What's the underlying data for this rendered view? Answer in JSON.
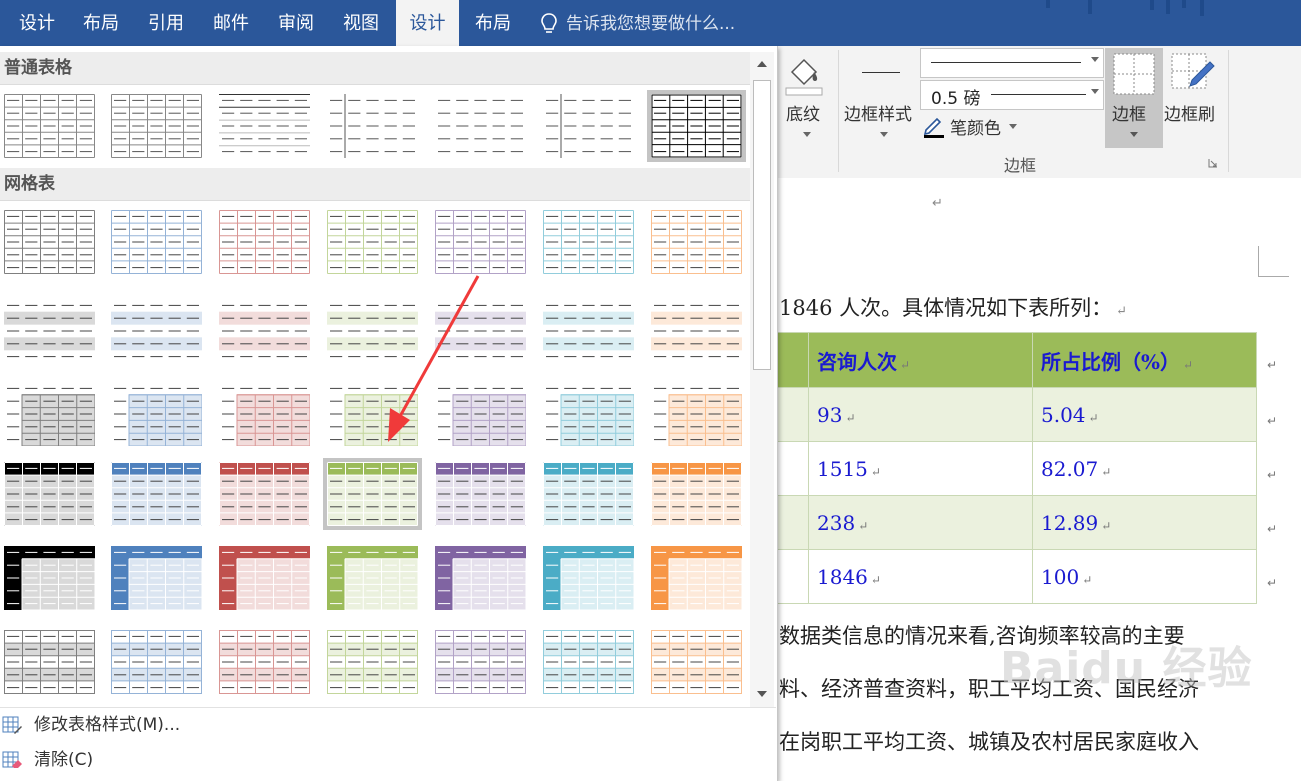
{
  "tabs": [
    {
      "label": "设计",
      "active": false
    },
    {
      "label": "布局",
      "active": false
    },
    {
      "label": "引用",
      "active": false
    },
    {
      "label": "邮件",
      "active": false
    },
    {
      "label": "审阅",
      "active": false
    },
    {
      "label": "视图",
      "active": false
    },
    {
      "label": "设计",
      "active": true
    },
    {
      "label": "布局",
      "active": false
    }
  ],
  "tell_me": "告诉我您想要做什么...",
  "ribbon": {
    "shading_label": "底纹",
    "border_style_label": "边框样式",
    "line_weight": "0.5 磅",
    "pen_color_label": "笔颜色",
    "borders_label": "边框",
    "border_painter_label": "边框刷",
    "group_label": "边框"
  },
  "gallery": {
    "plain_header": "普通表格",
    "grid_header": "网格表",
    "modify_label": "修改表格样式(M)...",
    "clear_label": "清除(C)",
    "accent_colors": [
      "#000000",
      "#4f81bd",
      "#c0504d",
      "#9bbb59",
      "#8064a2",
      "#4bacc6",
      "#f79646"
    ],
    "light_fills": [
      "#d9d9d9",
      "#dbe5f1",
      "#f2dcdb",
      "#ebf1de",
      "#e5e0ec",
      "#daeef3",
      "#fde9d9"
    ],
    "borders": [
      "#7f7f7f",
      "#95b3d7",
      "#d99694",
      "#c3d69b",
      "#b2a2c7",
      "#92cddc",
      "#fabf8f"
    ]
  },
  "document": {
    "line1": "1846 人次。具体情况如下表所列：",
    "table": {
      "headers": [
        "咨询人次",
        "所占比例（%）"
      ],
      "rows": [
        [
          "93",
          "5.04"
        ],
        [
          "1515",
          "82.07"
        ],
        [
          "238",
          "12.89"
        ],
        [
          "1846",
          "100"
        ]
      ]
    },
    "line2": "数据类信息的情况来看,咨询频率较高的主要",
    "line3": "料、经济普查资料，职工平均工资、国民经济",
    "line4": "在岗职工平均工资、城镇及农村居民家庭收入"
  },
  "watermark": "Baidu 经验"
}
